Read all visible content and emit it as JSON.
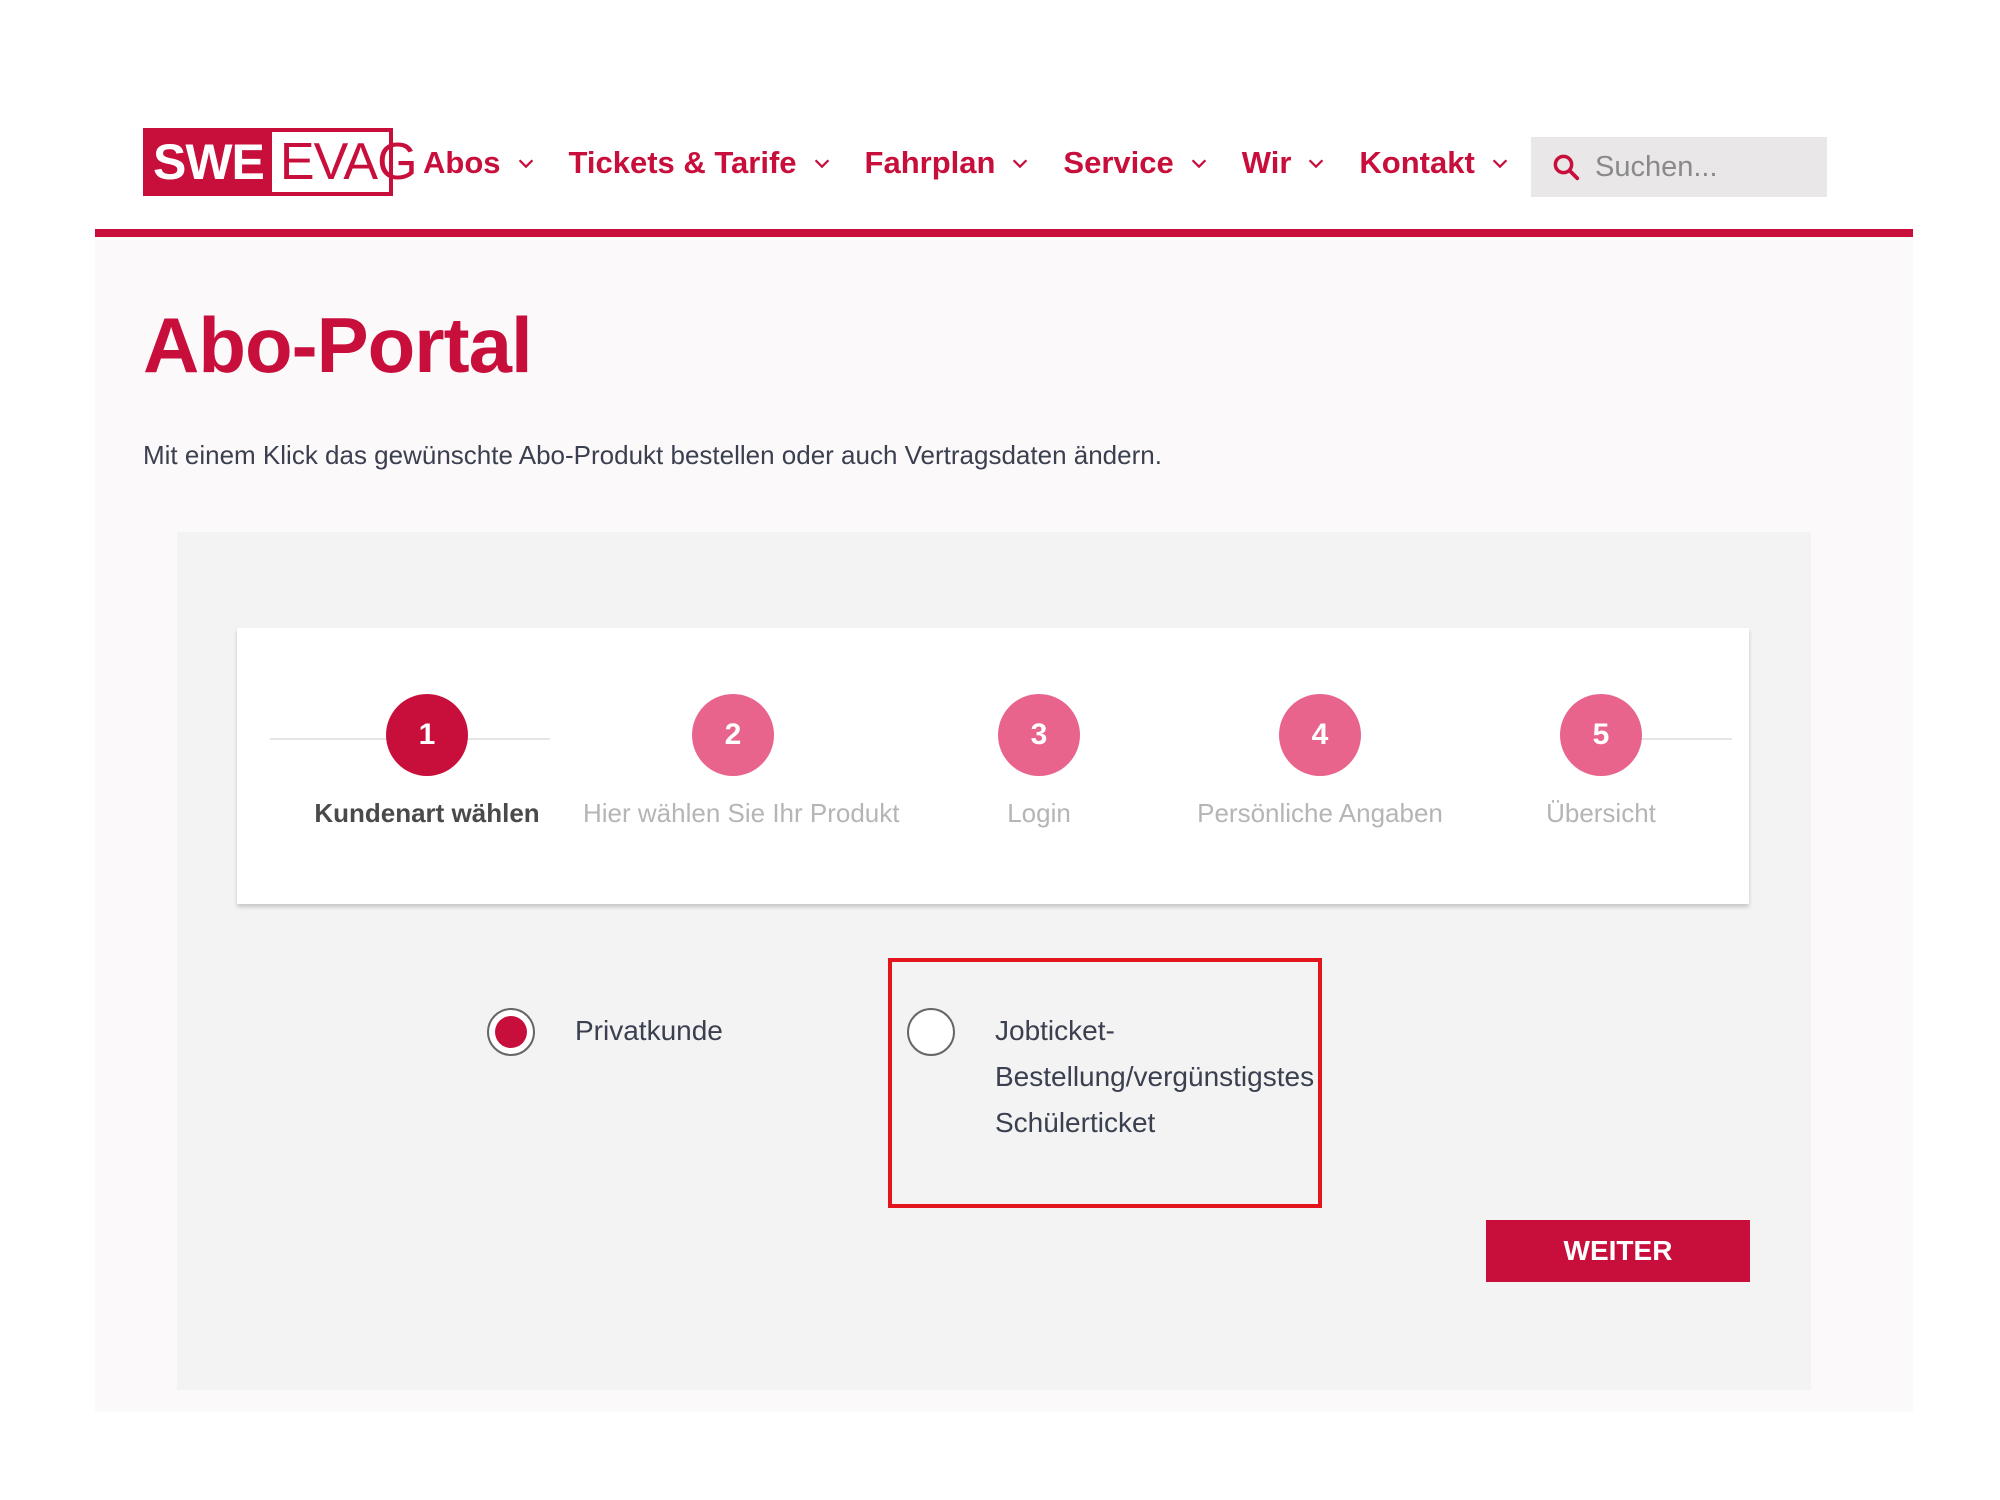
{
  "header": {
    "logo": {
      "left": "SWE",
      "right": "EVAG"
    },
    "nav": [
      {
        "label": "Abos"
      },
      {
        "label": "Tickets & Tarife"
      },
      {
        "label": "Fahrplan"
      },
      {
        "label": "Service"
      },
      {
        "label": "Wir"
      },
      {
        "label": "Kontakt"
      }
    ],
    "search": {
      "placeholder": "Suchen..."
    }
  },
  "page": {
    "title": "Abo-Portal",
    "intro": "Mit einem Klick das gewünschte Abo-Produkt bestellen oder auch Vertragsdaten ändern."
  },
  "stepper": {
    "active_step": 1,
    "steps": [
      {
        "number": "1",
        "label": "Kundenart wählen"
      },
      {
        "number": "2",
        "label": "Hier wählen Sie Ihr Produkt"
      },
      {
        "number": "3",
        "label": "Login"
      },
      {
        "number": "4",
        "label": "Persönliche Angaben"
      },
      {
        "number": "5",
        "label": "Übersicht"
      }
    ]
  },
  "customer_type": {
    "options": [
      {
        "label": "Privatkunde",
        "selected": true
      },
      {
        "label_lines": [
          "Jobticket-",
          "Bestellung/vergünstigstes",
          "Schülerticket"
        ],
        "selected": false
      }
    ]
  },
  "actions": {
    "next_label": "WEITER"
  },
  "colors": {
    "brand_red": "#c80f3c",
    "step_pink": "#e8648d",
    "highlight_red": "#e3141b"
  }
}
